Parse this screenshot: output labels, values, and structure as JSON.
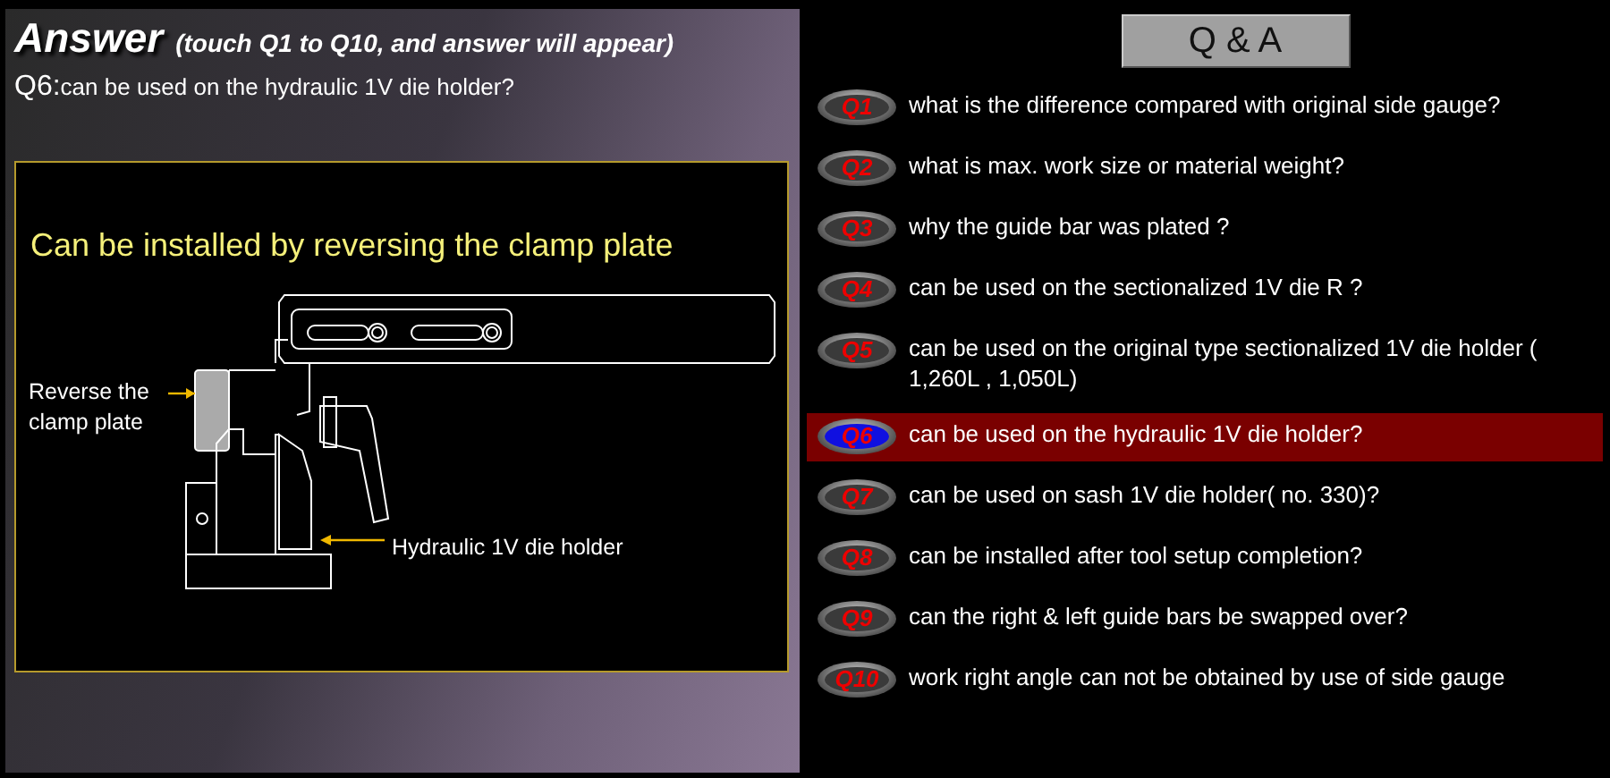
{
  "answer_panel": {
    "title": "Answer",
    "hint": "(touch Q1 to Q10, and answer will appear)",
    "question_label": "Q6:",
    "question_text": "can be used on the hydraulic 1V die holder?",
    "answer": {
      "headline": "Can be installed by reversing the clamp plate",
      "callouts": [
        {
          "text": "Reverse the"
        },
        {
          "text": "clamp plate"
        },
        {
          "text": "Hydraulic 1V die holder"
        }
      ]
    }
  },
  "qa_button": {
    "label": "Q & A"
  },
  "questions": [
    {
      "badge": "Q1",
      "text": "what is the difference compared with original side gauge?",
      "selected": false
    },
    {
      "badge": "Q2",
      "text": "what is max. work size or material weight?",
      "selected": false
    },
    {
      "badge": "Q3",
      "text": "why the guide bar was plated ?",
      "selected": false
    },
    {
      "badge": "Q4",
      "text": "can be used on the sectionalized 1V die R ?",
      "selected": false
    },
    {
      "badge": "Q5",
      "text": "can be used on the original type sectionalized 1V die holder ( 1,260L , 1,050L)",
      "selected": false
    },
    {
      "badge": "Q6",
      "text": "can be used on the hydraulic 1V die holder?",
      "selected": true
    },
    {
      "badge": "Q7",
      "text": "can be used on sash 1V die holder( no. 330)?",
      "selected": false
    },
    {
      "badge": "Q8",
      "text": "can be installed after tool setup completion?",
      "selected": false
    },
    {
      "badge": "Q9",
      "text": "can the right & left guide bars be swapped over?",
      "selected": false
    },
    {
      "badge": "Q10",
      "text": "work right angle can not be obtained by use of side gauge",
      "selected": false
    }
  ]
}
